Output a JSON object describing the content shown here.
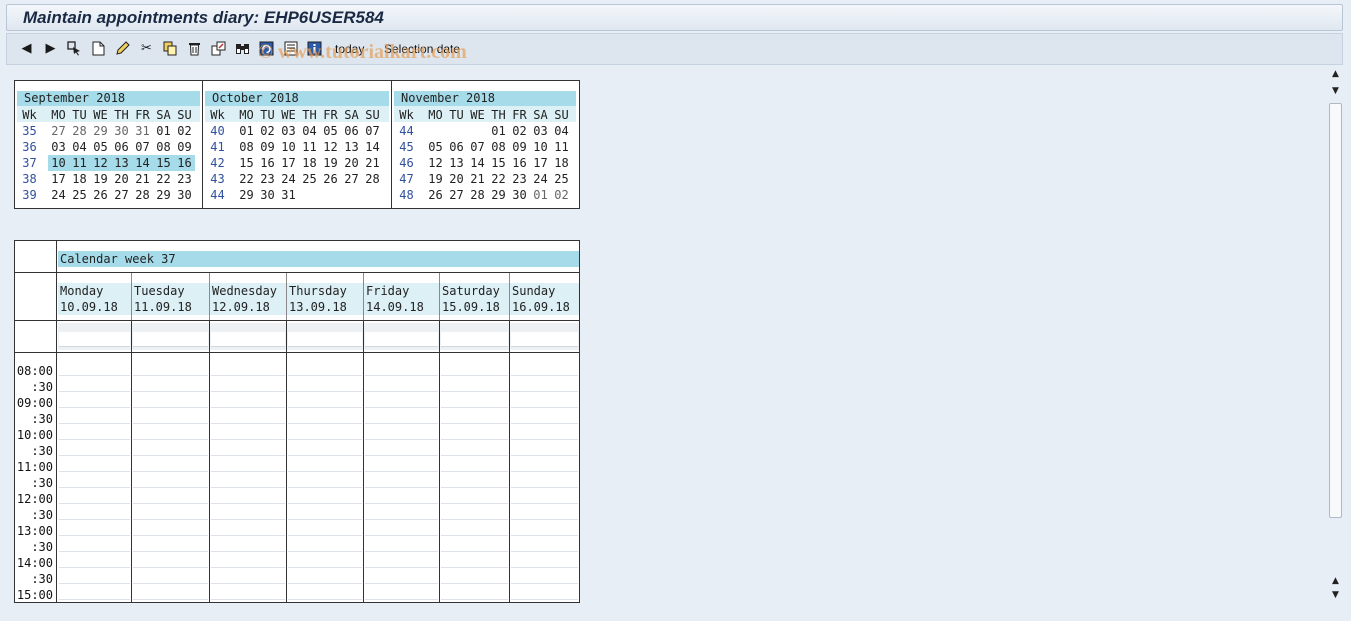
{
  "window": {
    "title": "Maintain appointments diary: EHP6USER584"
  },
  "toolbar": {
    "today_label": "today",
    "selection_label": "Selection date",
    "icons": [
      "back-icon",
      "forward-icon",
      "select-icon",
      "create-icon",
      "change-icon",
      "cut-icon",
      "copy-icon",
      "delete-icon",
      "transfer-icon",
      "find-icon",
      "refresh-icon",
      "details-icon",
      "info-icon"
    ]
  },
  "watermark": "© www.tutorialkart.com",
  "month_calendars": [
    {
      "title": "September 2018",
      "headers": [
        "Wk",
        "MO",
        "TU",
        "WE",
        "TH",
        "FR",
        "SA",
        "SU"
      ],
      "weeks": [
        {
          "wk": "35",
          "days": [
            "27",
            "28",
            "29",
            "30",
            "31",
            "01",
            "02"
          ],
          "other": [
            0,
            1,
            2,
            3,
            4
          ]
        },
        {
          "wk": "36",
          "days": [
            "03",
            "04",
            "05",
            "06",
            "07",
            "08",
            "09"
          ],
          "other": []
        },
        {
          "wk": "37",
          "days": [
            "10",
            "11",
            "12",
            "13",
            "14",
            "15",
            "16"
          ],
          "other": [],
          "selected": true
        },
        {
          "wk": "38",
          "days": [
            "17",
            "18",
            "19",
            "20",
            "21",
            "22",
            "23"
          ],
          "other": []
        },
        {
          "wk": "39",
          "days": [
            "24",
            "25",
            "26",
            "27",
            "28",
            "29",
            "30"
          ],
          "other": []
        }
      ]
    },
    {
      "title": "October 2018",
      "headers": [
        "Wk",
        "MO",
        "TU",
        "WE",
        "TH",
        "FR",
        "SA",
        "SU"
      ],
      "weeks": [
        {
          "wk": "40",
          "days": [
            "01",
            "02",
            "03",
            "04",
            "05",
            "06",
            "07"
          ],
          "other": []
        },
        {
          "wk": "41",
          "days": [
            "08",
            "09",
            "10",
            "11",
            "12",
            "13",
            "14"
          ],
          "other": []
        },
        {
          "wk": "42",
          "days": [
            "15",
            "16",
            "17",
            "18",
            "19",
            "20",
            "21"
          ],
          "other": []
        },
        {
          "wk": "43",
          "days": [
            "22",
            "23",
            "24",
            "25",
            "26",
            "27",
            "28"
          ],
          "other": []
        },
        {
          "wk": "44",
          "days": [
            "29",
            "30",
            "31",
            "",
            "",
            "",
            ""
          ],
          "other": []
        }
      ]
    },
    {
      "title": "November 2018",
      "headers": [
        "Wk",
        "MO",
        "TU",
        "WE",
        "TH",
        "FR",
        "SA",
        "SU"
      ],
      "weeks": [
        {
          "wk": "44",
          "days": [
            "",
            "",
            "",
            "01",
            "02",
            "03",
            "04"
          ],
          "other": []
        },
        {
          "wk": "45",
          "days": [
            "05",
            "06",
            "07",
            "08",
            "09",
            "10",
            "11"
          ],
          "other": []
        },
        {
          "wk": "46",
          "days": [
            "12",
            "13",
            "14",
            "15",
            "16",
            "17",
            "18"
          ],
          "other": []
        },
        {
          "wk": "47",
          "days": [
            "19",
            "20",
            "21",
            "22",
            "23",
            "24",
            "25"
          ],
          "other": []
        },
        {
          "wk": "48",
          "days": [
            "26",
            "27",
            "28",
            "29",
            "30",
            "01",
            "02"
          ],
          "other": [
            5,
            6
          ]
        }
      ]
    }
  ],
  "week_view": {
    "title": "Calendar week 37",
    "days": [
      {
        "name": "Monday",
        "date": "10.09.18"
      },
      {
        "name": "Tuesday",
        "date": "11.09.18"
      },
      {
        "name": "Wednesday",
        "date": "12.09.18"
      },
      {
        "name": "Thursday",
        "date": "13.09.18"
      },
      {
        "name": "Friday",
        "date": "14.09.18"
      },
      {
        "name": "Saturday",
        "date": "15.09.18"
      },
      {
        "name": "Sunday",
        "date": "16.09.18"
      }
    ],
    "times": [
      "08:00",
      ":30",
      "09:00",
      ":30",
      "10:00",
      ":30",
      "11:00",
      ":30",
      "12:00",
      ":30",
      "13:00",
      ":30",
      "14:00",
      ":30",
      "15:00"
    ]
  }
}
